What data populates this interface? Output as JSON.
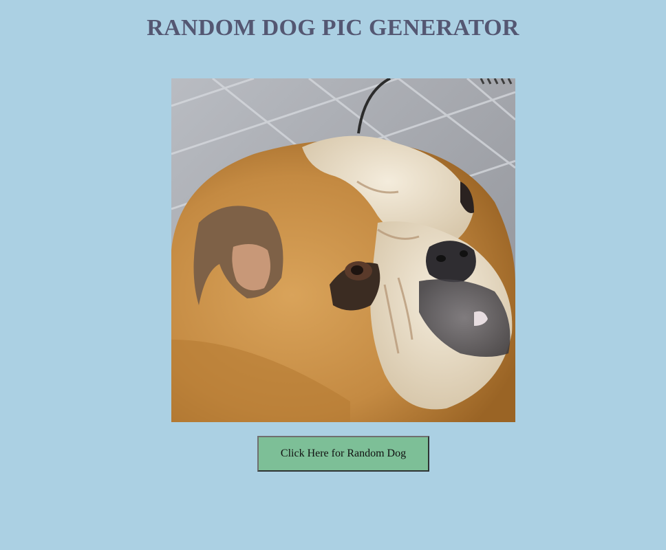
{
  "page": {
    "title": "RANDOM DOG PIC GENERATOR",
    "background_color": "#abd0e3",
    "title_color": "#545772"
  },
  "dog_image": {
    "alt": "dog",
    "subject": "english-bulldog-photo"
  },
  "button": {
    "label": "Click Here for Random Dog",
    "color": "#7dbf97"
  }
}
